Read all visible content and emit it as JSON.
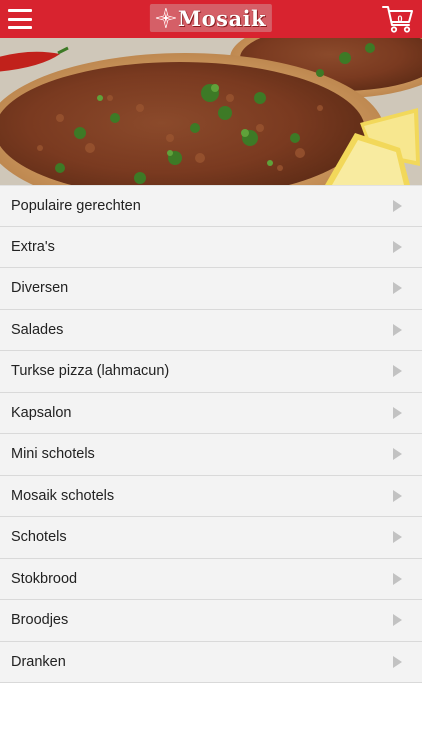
{
  "app": {
    "brand": "Mosaik",
    "accent_color": "#d8232f"
  },
  "header": {
    "menu_icon": "hamburger-icon",
    "logo_text": "Mosaik",
    "cart_icon": "shopping-cart-icon",
    "cart_count": "0"
  },
  "hero": {
    "image_subject": "lahmacun pizza with parsley and lemon"
  },
  "menu": {
    "items": [
      {
        "label": "Populaire gerechten"
      },
      {
        "label": "Extra's"
      },
      {
        "label": "Diversen"
      },
      {
        "label": "Salades"
      },
      {
        "label": "Turkse pizza (lahmacun)"
      },
      {
        "label": "Kapsalon"
      },
      {
        "label": "Mini schotels"
      },
      {
        "label": "Mosaik schotels"
      },
      {
        "label": "Schotels"
      },
      {
        "label": "Stokbrood"
      },
      {
        "label": "Broodjes"
      },
      {
        "label": "Dranken"
      }
    ]
  }
}
